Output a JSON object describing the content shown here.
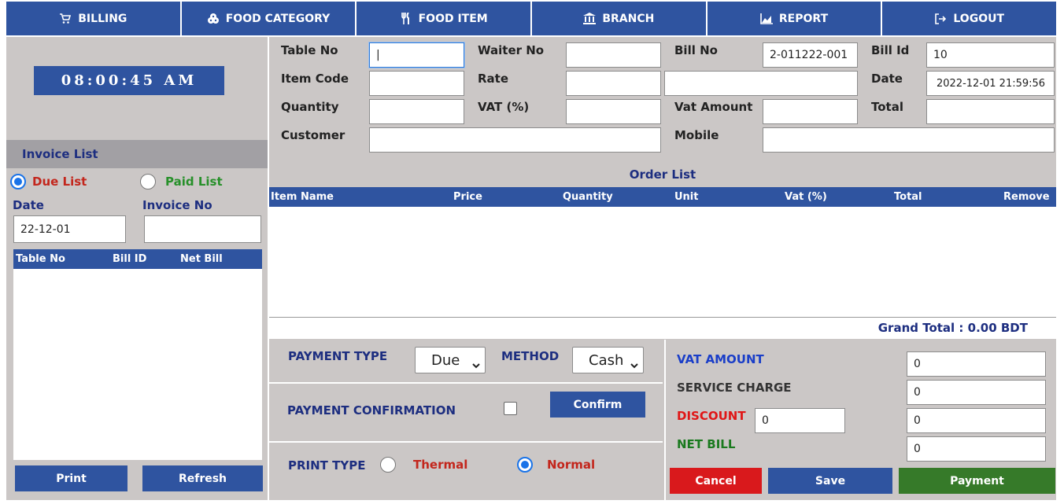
{
  "nav": [
    {
      "label": "BILLING",
      "icon": "cart-icon"
    },
    {
      "label": "FOOD CATEGORY",
      "icon": "cookie-icon"
    },
    {
      "label": "FOOD ITEM",
      "icon": "utensils-icon"
    },
    {
      "label": "BRANCH",
      "icon": "bank-icon"
    },
    {
      "label": "REPORT",
      "icon": "chart-icon"
    },
    {
      "label": "LOGOUT",
      "icon": "logout-icon"
    }
  ],
  "left": {
    "clock": "08:00:45 AM",
    "invoice_title": "Invoice List",
    "due_label": "Due List",
    "paid_label": "Paid List",
    "date_label": "Date",
    "invoice_no_label": "Invoice No",
    "date_value": "22-12-01",
    "invoice_no_value": "",
    "table_headers": [
      "Table No",
      "Bill ID",
      "Net Bill"
    ],
    "print_label": "Print",
    "refresh_label": "Refresh"
  },
  "form": {
    "table_no_label": "Table No",
    "table_no_value": "|",
    "waiter_no_label": "Waiter No",
    "waiter_no_value": "",
    "bill_no_label": "Bill No",
    "bill_no_value": "2-011222-001",
    "bill_id_label": "Bill Id",
    "bill_id_value": "10",
    "item_code_label": "Item Code",
    "item_code_value": "",
    "rate_label": "Rate",
    "rate_value": "",
    "item_name_value": "",
    "date_label": "Date",
    "date_value": "2022-12-01 21:59:56",
    "quantity_label": "Quantity",
    "quantity_value": "",
    "vat_label": "VAT (%)",
    "vat_value": "",
    "vat_amount_label": "Vat Amount",
    "vat_amount_value": "",
    "total_label": "Total",
    "total_value": "",
    "customer_label": "Customer",
    "customer_value": "",
    "mobile_label": "Mobile",
    "mobile_value": ""
  },
  "order": {
    "title": "Order List",
    "headers": [
      "Item Name",
      "Price",
      "Quantity",
      "Unit",
      "Vat (%)",
      "Total",
      "Remove"
    ],
    "grand_total": "Grand Total : 0.00 BDT"
  },
  "payment": {
    "type_label": "PAYMENT TYPE",
    "type_value": "Due",
    "method_label": "METHOD",
    "method_value": "Cash",
    "confirmation_label": "PAYMENT CONFIRMATION",
    "confirm_button": "Confirm",
    "print_type_label": "PRINT TYPE",
    "thermal_label": "Thermal",
    "normal_label": "Normal"
  },
  "summary": {
    "vat_amount_label": "VAT AMOUNT",
    "vat_amount_value": "0",
    "service_charge_label": "SERVICE CHARGE",
    "service_charge_value": "0",
    "discount_label": "DISCOUNT",
    "discount_input_value": "0",
    "discount_value": "0",
    "net_bill_label": "NET BILL",
    "net_bill_value": "0",
    "cancel_label": "Cancel",
    "save_label": "Save",
    "payment_label": "Payment"
  },
  "colors": {
    "primary": "#2f54a0",
    "panel": "#cbc7c6",
    "cancel": "#d9191c",
    "payment": "#367a29",
    "due_text": "#c3261c",
    "paid_text": "#27902a",
    "discount_text": "#e01616",
    "net_bill_text": "#1a7a1e"
  }
}
